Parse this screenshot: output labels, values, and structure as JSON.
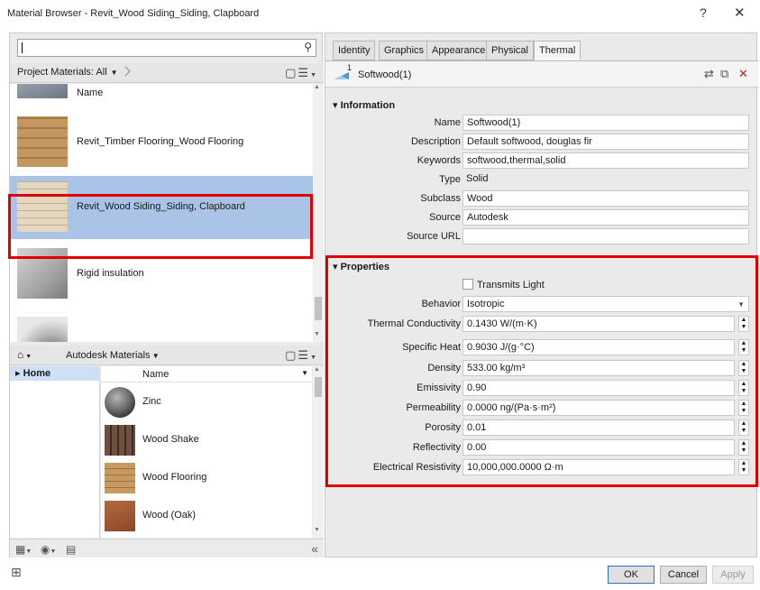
{
  "window": {
    "title": "Material Browser - Revit_Wood Siding_Siding, Clapboard",
    "help": "?",
    "close": "✕"
  },
  "search": {
    "value": "",
    "icon": "search-icon",
    "icon_glyph": "⚲"
  },
  "project": {
    "header": "Project Materials: All",
    "column_name": "Name",
    "items": [
      {
        "label": "",
        "color": "#8f9aa5"
      },
      {
        "label": "Revit_Timber Flooring_Wood Flooring",
        "color": "#c39860"
      },
      {
        "label": "Revit_Wood Siding_Siding, Clapboard",
        "color": "#d9ccb2",
        "selected": true
      },
      {
        "label": "Rigid insulation",
        "color": "#b8b8b8"
      }
    ]
  },
  "library": {
    "header": "Autodesk Materials",
    "tree_home": "Home",
    "column_name": "Name",
    "items": [
      {
        "label": "Zinc",
        "color": "#6f6f6f"
      },
      {
        "label": "Wood Shake",
        "color": "#6e5040"
      },
      {
        "label": "Wood Flooring",
        "color": "#b8884f"
      },
      {
        "label": "Wood (Oak)",
        "color": "#9c5a36"
      }
    ]
  },
  "tabs": [
    "Identity",
    "Graphics",
    "Appearance",
    "Physical",
    "Thermal"
  ],
  "active_tab": "Thermal",
  "asset": {
    "number": "1",
    "name": "Softwood(1)"
  },
  "information": {
    "title": "▾ Information",
    "rows": [
      {
        "label": "Name",
        "value": "Softwood(1)"
      },
      {
        "label": "Description",
        "value": "Default softwood, douglas fir"
      },
      {
        "label": "Keywords",
        "value": "softwood,thermal,solid"
      },
      {
        "label": "Type",
        "value": "Solid"
      },
      {
        "label": "Subclass",
        "value": "Wood"
      },
      {
        "label": "Source",
        "value": "Autodesk"
      },
      {
        "label": "Source URL",
        "value": ""
      }
    ]
  },
  "properties": {
    "title": "▾ Properties",
    "transmits_light": "Transmits Light",
    "behavior": {
      "label": "Behavior",
      "value": "Isotropic"
    },
    "rows": [
      {
        "label": "Thermal Conductivity",
        "value": "0.1430 W/(m·K)"
      },
      {
        "label": "Specific Heat",
        "value": "0.9030 J/(g·°C)"
      },
      {
        "label": "Density",
        "value": "533.00 kg/m³"
      },
      {
        "label": "Emissivity",
        "value": "0.90"
      },
      {
        "label": "Permeability",
        "value": "0.0000 ng/(Pa·s·m²)"
      },
      {
        "label": "Porosity",
        "value": "0.01"
      },
      {
        "label": "Reflectivity",
        "value": "0.00"
      },
      {
        "label": "Electrical Resistivity",
        "value": "10,000,000.0000 Ω·m"
      }
    ]
  },
  "buttons": {
    "ok": "OK",
    "cancel": "Cancel",
    "apply": "Apply"
  }
}
